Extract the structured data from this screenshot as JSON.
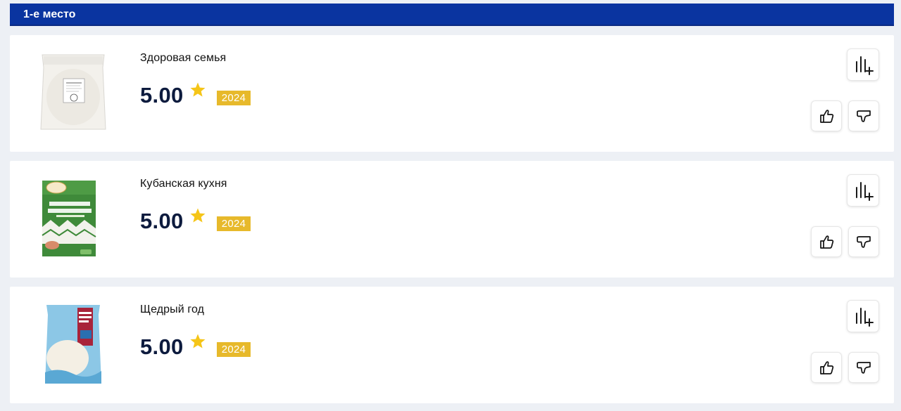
{
  "section": {
    "title": "1-е место"
  },
  "products": [
    {
      "name": "Здоровая семья",
      "rating": "5.00",
      "year": "2024",
      "image": "rice-bag-white-transparent"
    },
    {
      "name": "Кубанская кухня",
      "rating": "5.00",
      "year": "2024",
      "image": "rice-pack-green"
    },
    {
      "name": "Щедрый год",
      "rating": "5.00",
      "year": "2024",
      "image": "rice-bag-blue-red"
    }
  ],
  "icons": {
    "star": "star-icon",
    "compare": "compare-bars-plus-icon",
    "like": "thumbs-up-icon",
    "dislike": "thumbs-down-icon"
  },
  "colors": {
    "header_bg": "#0a34a0",
    "rating_text": "#0d1b3e",
    "star": "#f5c518",
    "year_badge": "#e7b92b",
    "page_bg": "#edf0f5"
  }
}
